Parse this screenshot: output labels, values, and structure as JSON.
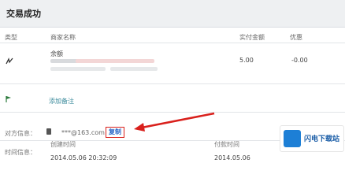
{
  "header": {
    "title": "交易成功"
  },
  "table": {
    "columns": [
      "类型",
      "商家名称",
      "",
      "",
      "",
      "",
      "",
      "",
      "实付金额",
      "优惠"
    ],
    "row": {
      "name": "余额",
      "amount": "5.00",
      "discount": "-0.00"
    }
  },
  "note_link": "添加备注",
  "payment": {
    "paid_label": "对方信息：",
    "account_masked": "***@163.com",
    "copy_label": "复制",
    "time_label": "时间信息：",
    "create_label": "创建时间",
    "pay_label": "付款时间",
    "create_time": "2014.05.06 20:32:09",
    "pay_time": "2014.05.06"
  },
  "watermark": {
    "text": "闪电下载站"
  },
  "colors": {
    "accent": "#d9201c",
    "link": "#2a66c7"
  }
}
